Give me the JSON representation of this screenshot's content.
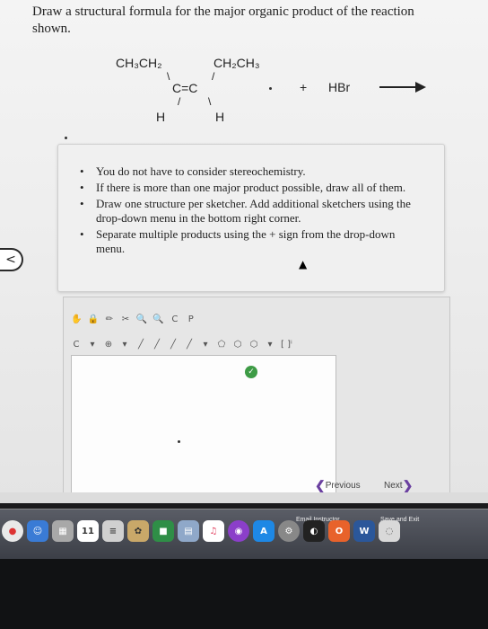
{
  "question": {
    "text": "Draw a structural formula for the major organic product of the reaction shown."
  },
  "reaction": {
    "left_top": "CH₃CH₂",
    "right_top": "CH₂CH₃",
    "double_bond": "C=C",
    "left_bottom": "H",
    "right_bottom": "H",
    "bond_left_top": "\\",
    "bond_right_top": "/",
    "bond_left_bottom": "/",
    "bond_right_bottom": "\\",
    "plus": "+",
    "reagent": "HBr"
  },
  "instructions": [
    "You do not have to consider stereochemistry.",
    "If there is more than one major product possible, draw all of them.",
    "Draw one structure per sketcher. Add additional sketchers using the drop-down menu in the bottom right corner.",
    "Separate multiple products using the + sign from the drop-down menu."
  ],
  "back_tab": {
    "glyph": "<"
  },
  "sketcher": {
    "toolbar_row1": [
      "✋",
      "🔒",
      "✏",
      "✂",
      "🔍",
      "🔍",
      "C",
      "P"
    ],
    "toolbar_row2": [
      "C",
      "▾",
      "⊕",
      "▾",
      "╱",
      "╱",
      "╱",
      "╱",
      "▾",
      "⬠",
      "⬡",
      "⬡",
      "▾",
      "[ ]ⁱ"
    ],
    "green_button": "✓"
  },
  "navigation": {
    "prev_label": "Previous",
    "next_label": "Next"
  },
  "footer": {
    "email_label": "Email Instructor",
    "save_label": "Save and Exit"
  },
  "dock": {
    "calendar_day": "11",
    "items": [
      "chrome",
      "finder",
      "calendar",
      "notes",
      "photos",
      "facetime",
      "preview",
      "music",
      "podcasts",
      "appstore",
      "settings",
      "office",
      "word",
      "misc"
    ]
  }
}
